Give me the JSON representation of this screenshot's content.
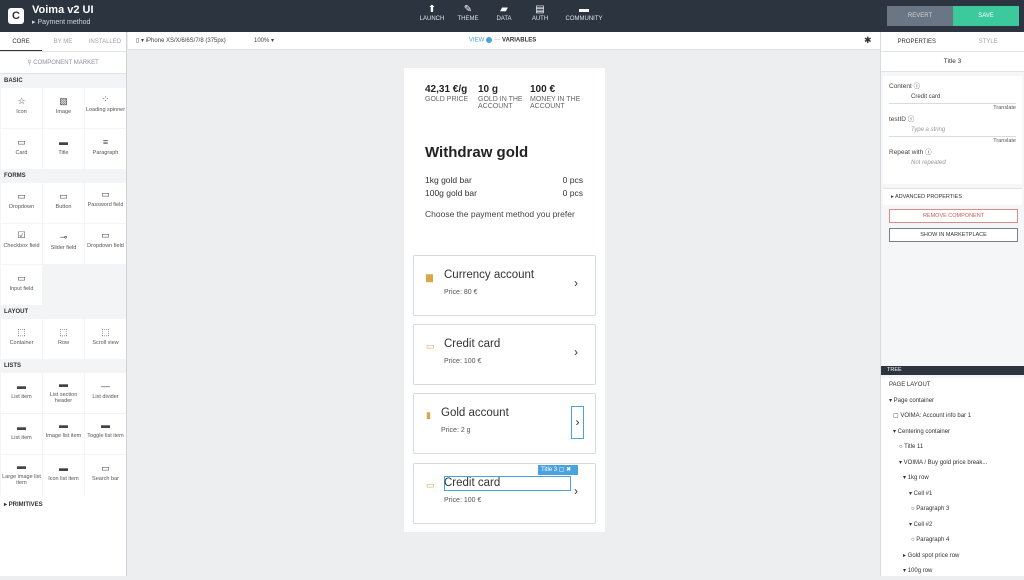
{
  "app": {
    "title": "Voima v2 UI",
    "subtitle": "▸ Payment method",
    "logo": "C"
  },
  "topnav": [
    {
      "label": "LAUNCH",
      "icon": "launch-icon",
      "glyph": "⬆"
    },
    {
      "label": "THEME",
      "icon": "theme-icon",
      "glyph": "✎"
    },
    {
      "label": "DATA",
      "icon": "folder-icon",
      "glyph": "▰"
    },
    {
      "label": "AUTH",
      "icon": "document-icon",
      "glyph": "▤"
    },
    {
      "label": "COMMUNITY",
      "icon": "chat-icon",
      "glyph": "▬"
    }
  ],
  "actions": {
    "revert": "REVERT",
    "save": "SAVE"
  },
  "left": {
    "tabs": [
      "CORE",
      "BY ME",
      "INSTALLED"
    ],
    "market": "COMPONENT MARKET",
    "sections": {
      "basic": {
        "title": "BASIC",
        "items": [
          {
            "label": "Icon",
            "glyph": "☆"
          },
          {
            "label": "Image",
            "glyph": "▧"
          },
          {
            "label": "Loading spinner",
            "glyph": "⁘"
          },
          {
            "label": "Card",
            "glyph": "▭"
          },
          {
            "label": "Title",
            "glyph": "▬"
          },
          {
            "label": "Paragraph",
            "glyph": "≡"
          }
        ]
      },
      "forms": {
        "title": "FORMS",
        "items": [
          {
            "label": "Dropdown",
            "glyph": "▭"
          },
          {
            "label": "Button",
            "glyph": "▭"
          },
          {
            "label": "Password field",
            "glyph": "▭"
          },
          {
            "label": "Checkbox field",
            "glyph": "☑"
          },
          {
            "label": "Slider field",
            "glyph": "⊸"
          },
          {
            "label": "Dropdown field",
            "glyph": "▭"
          },
          {
            "label": "Input field",
            "glyph": "▭"
          }
        ]
      },
      "layout": {
        "title": "LAYOUT",
        "items": [
          {
            "label": "Container",
            "glyph": "⬚"
          },
          {
            "label": "Row",
            "glyph": "⬚"
          },
          {
            "label": "Scroll view",
            "glyph": "⬚"
          }
        ]
      },
      "lists": {
        "title": "LISTS",
        "items": [
          {
            "label": "List item",
            "glyph": "▬"
          },
          {
            "label": "List section header",
            "glyph": "▬"
          },
          {
            "label": "List divider",
            "glyph": "—"
          },
          {
            "label": "List item",
            "glyph": "▬"
          },
          {
            "label": "Image list item",
            "glyph": "▬"
          },
          {
            "label": "Toggle list item",
            "glyph": "▬"
          },
          {
            "label": "Large image list item",
            "glyph": "▬"
          },
          {
            "label": "Icon list item",
            "glyph": "▬"
          },
          {
            "label": "Search bar",
            "glyph": "▭"
          }
        ]
      }
    },
    "primitives": "▸ PRIMITIVES"
  },
  "canvas": {
    "device": "▾ iPhone XS/X/6/6S/7/8 (375px)",
    "zoom": "100% ▾",
    "view": "VIEW",
    "variables": "VARIABLES"
  },
  "phone": {
    "stats": [
      {
        "value": "42,31 €/g",
        "label": "GOLD PRICE"
      },
      {
        "value": "10 g",
        "label": "GOLD IN THE ACCOUNT"
      },
      {
        "value": "100 €",
        "label": "MONEY IN THE ACCOUNT"
      }
    ],
    "title": "Withdraw gold",
    "rows": [
      {
        "name": "1kg gold bar",
        "qty": "0 pcs"
      },
      {
        "name": "100g gold bar",
        "qty": "0 pcs"
      }
    ],
    "prompt": "Choose the payment method you prefer",
    "cards": [
      {
        "title": "Currency account",
        "price": "Price: 80 €"
      },
      {
        "title": "Credit card",
        "price": "Price: 100 €"
      },
      {
        "title": "Gold account",
        "price": "Price: 2 g"
      },
      {
        "title": "Credit card",
        "price": "Price: 100 €"
      }
    ],
    "selection_tag": "Title 3 ▢ ✖"
  },
  "right": {
    "tabs": [
      "PROPERTIES",
      "STYLE"
    ],
    "selected": "Title 3",
    "content": {
      "label": "Content ⓘ",
      "value": "Credit card",
      "translate": "Translate"
    },
    "testid": {
      "label": "testID ⓘ",
      "placeholder": "Type a string",
      "translate": "Translate"
    },
    "repeat": {
      "label": "Repeat with ⓘ",
      "value": "Not repeated"
    },
    "advanced": "▸ ADVANCED PROPERTIES",
    "remove": "REMOVE COMPONENT",
    "marketplace": "SHOW IN MARKETPLACE",
    "tree_header": "TREE",
    "tree": [
      {
        "label": "PAGE LAYOUT",
        "depth": 0
      },
      {
        "label": "▾ Page container",
        "depth": 0
      },
      {
        "label": "▢ VOIMA: Account info bar 1",
        "depth": 1
      },
      {
        "label": "▾ Centering container",
        "depth": 1
      },
      {
        "label": "○ Title 11",
        "depth": 2
      },
      {
        "label": "▾ VOIMA / Buy gold price break...",
        "depth": 2
      },
      {
        "label": "▾ 1kg row",
        "depth": 3
      },
      {
        "label": "▾ Cell #1",
        "depth": 4
      },
      {
        "label": "○ Paragraph 3",
        "depth": 5
      },
      {
        "label": "▾ Cell #2",
        "depth": 4
      },
      {
        "label": "○ Paragraph 4",
        "depth": 5
      },
      {
        "label": "▸ Gold spot price row",
        "depth": 3
      },
      {
        "label": "▾ 100g row",
        "depth": 3
      }
    ]
  }
}
